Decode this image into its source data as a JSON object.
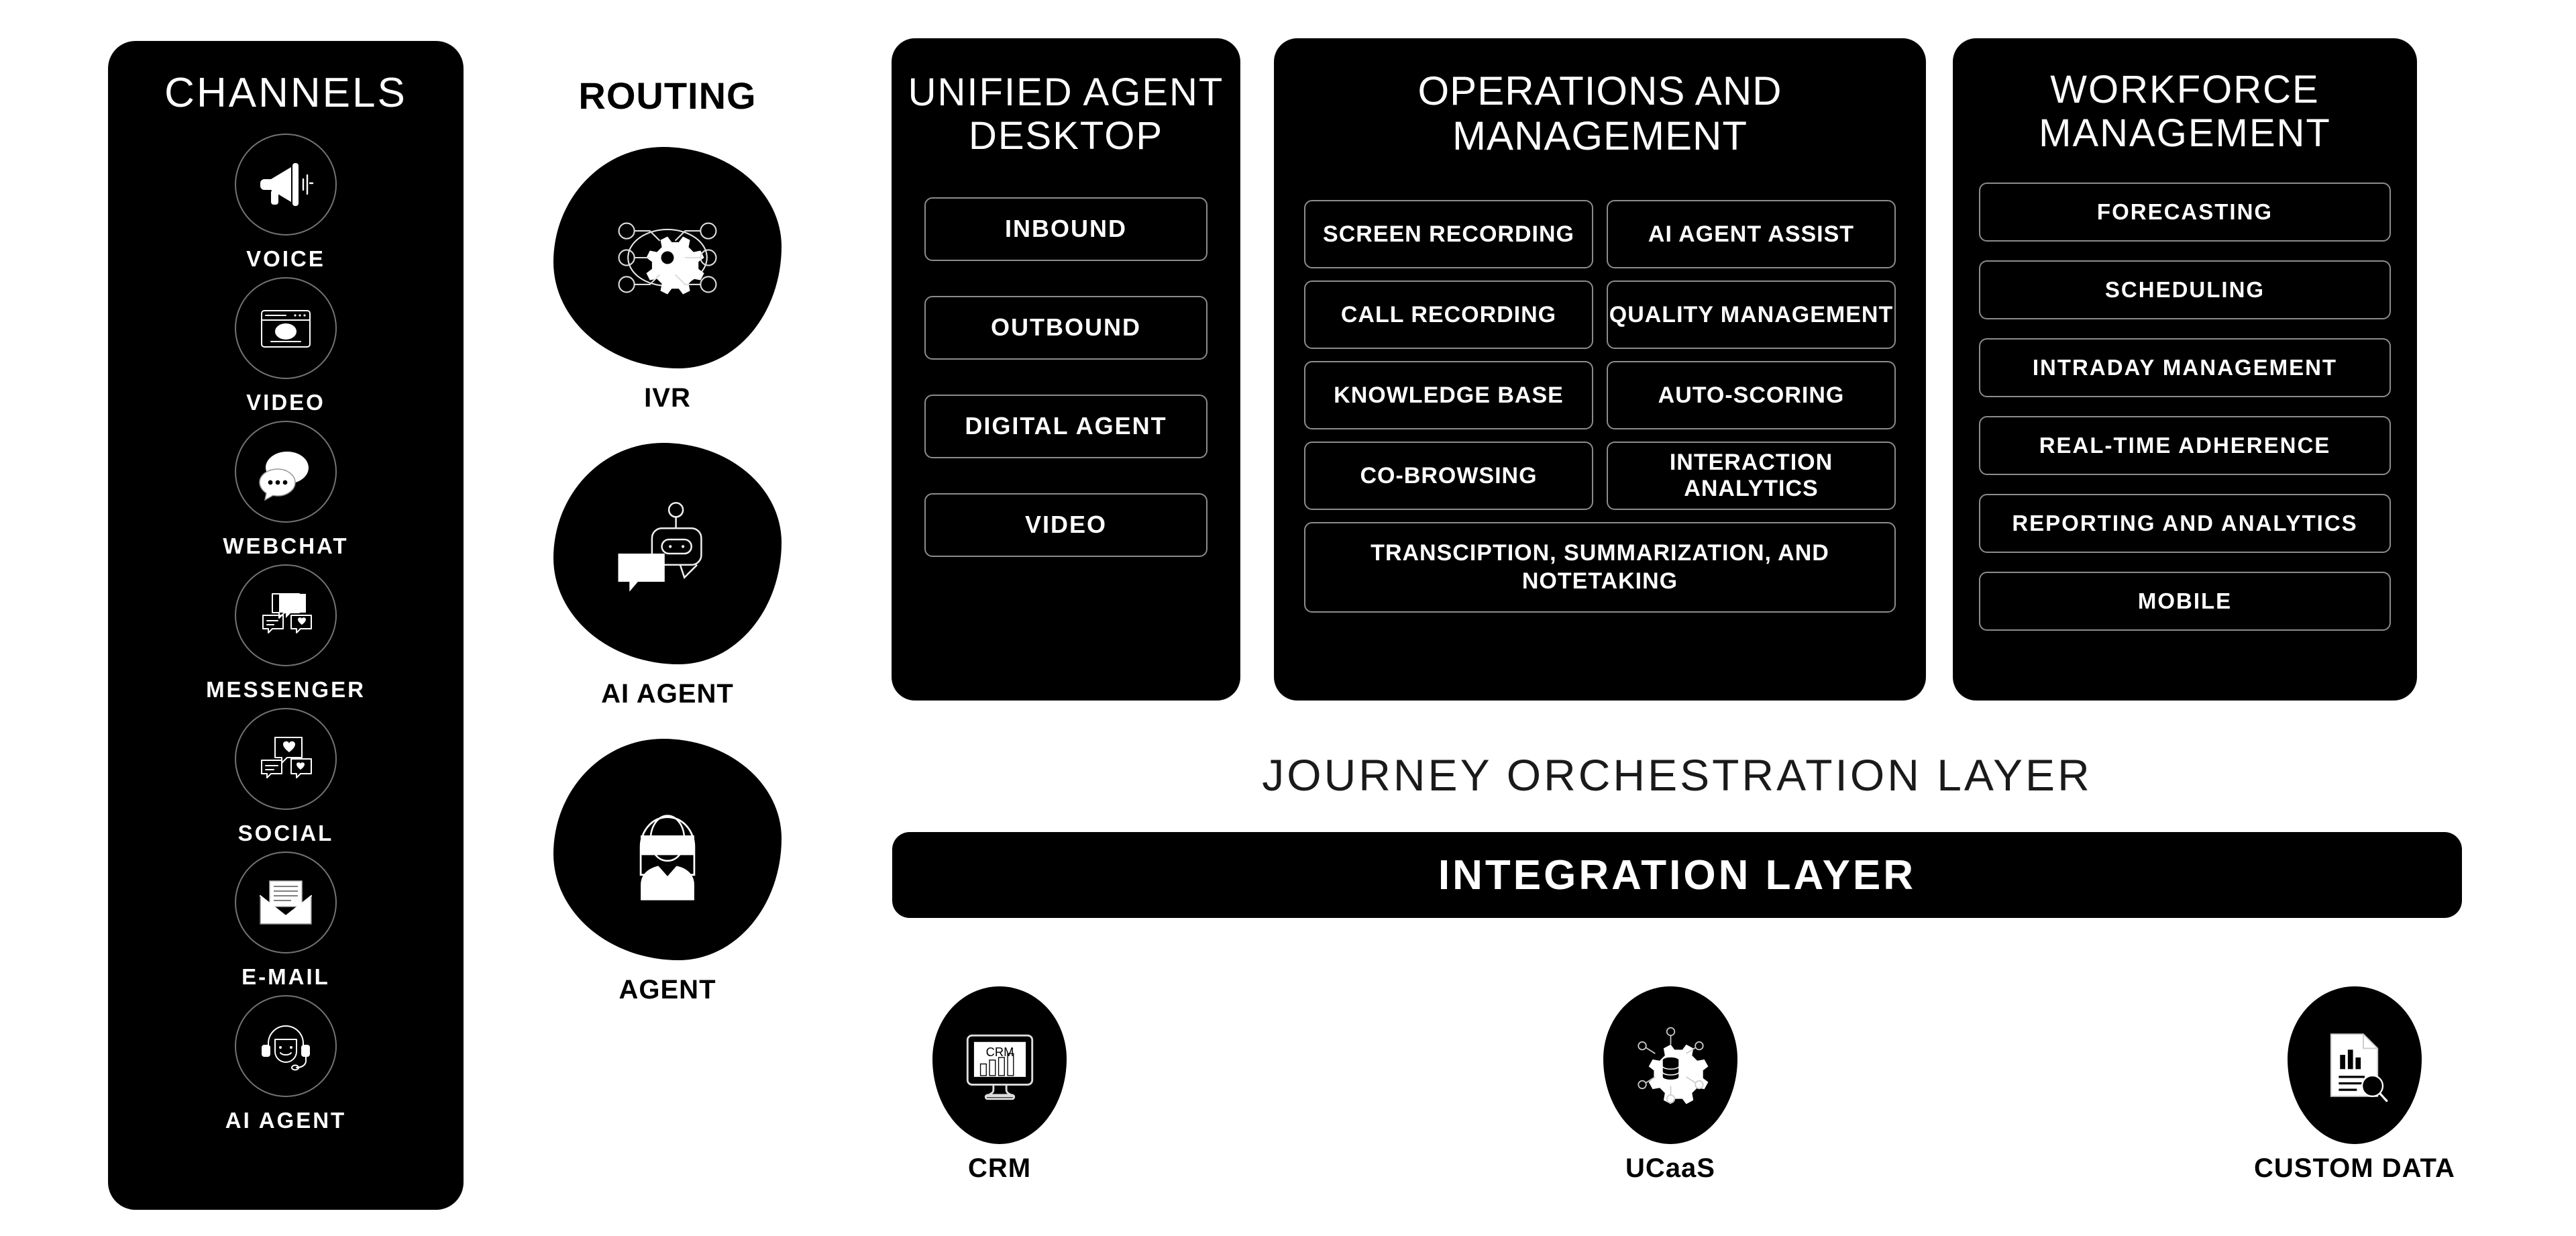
{
  "colors": {
    "panel_bg": "#000000",
    "page_bg": "#ffffff",
    "text_on_dark": "#ffffff",
    "text_on_light": "#000000"
  },
  "channels": {
    "title": "CHANNELS",
    "items": [
      {
        "label": "VOICE",
        "icon": "megaphone-icon"
      },
      {
        "label": "VIDEO",
        "icon": "video-window-icon"
      },
      {
        "label": "WEBCHAT",
        "icon": "chat-bubbles-icon"
      },
      {
        "label": "MESSENGER",
        "icon": "messenger-bubbles-icon"
      },
      {
        "label": "SOCIAL",
        "icon": "social-hearts-icon"
      },
      {
        "label": "E-MAIL",
        "icon": "envelope-icon"
      },
      {
        "label": "AI AGENT",
        "icon": "headset-agent-icon"
      }
    ]
  },
  "routing": {
    "title": "ROUTING",
    "items": [
      {
        "label": "IVR",
        "icon": "gear-network-icon"
      },
      {
        "label": "AI AGENT",
        "icon": "chatbot-icon"
      },
      {
        "label": "AGENT",
        "icon": "person-agent-icon"
      }
    ]
  },
  "unified_agent_desktop": {
    "title": "UNIFIED AGENT DESKTOP",
    "items": [
      "INBOUND",
      "OUTBOUND",
      "DIGITAL AGENT",
      "VIDEO"
    ]
  },
  "operations_management": {
    "title": "OPERATIONS AND MANAGEMENT",
    "items": [
      "SCREEN RECORDING",
      "AI AGENT ASSIST",
      "CALL RECORDING",
      "QUALITY MANAGEMENT",
      "KNOWLEDGE BASE",
      "AUTO-SCORING",
      "CO-BROWSING",
      "INTERACTION ANALYTICS"
    ],
    "wide_item": "TRANSCIPTION, SUMMARIZATION, AND NOTETAKING"
  },
  "workforce_management": {
    "title": "WORKFORCE MANAGEMENT",
    "items": [
      "FORECASTING",
      "SCHEDULING",
      "INTRADAY MANAGEMENT",
      "REAL-TIME ADHERENCE",
      "REPORTING AND ANALYTICS",
      "MOBILE"
    ]
  },
  "journey_layer": {
    "label": "JOURNEY ORCHESTRATION LAYER"
  },
  "integration_layer": {
    "label": "INTEGRATION LAYER"
  },
  "systems": [
    {
      "label": "CRM",
      "icon": "crm-monitor-icon",
      "screen_text": "CRM"
    },
    {
      "label": "UCaaS",
      "icon": "ucaas-gear-icon"
    },
    {
      "label": "CUSTOM DATA",
      "icon": "custom-data-report-icon"
    }
  ]
}
